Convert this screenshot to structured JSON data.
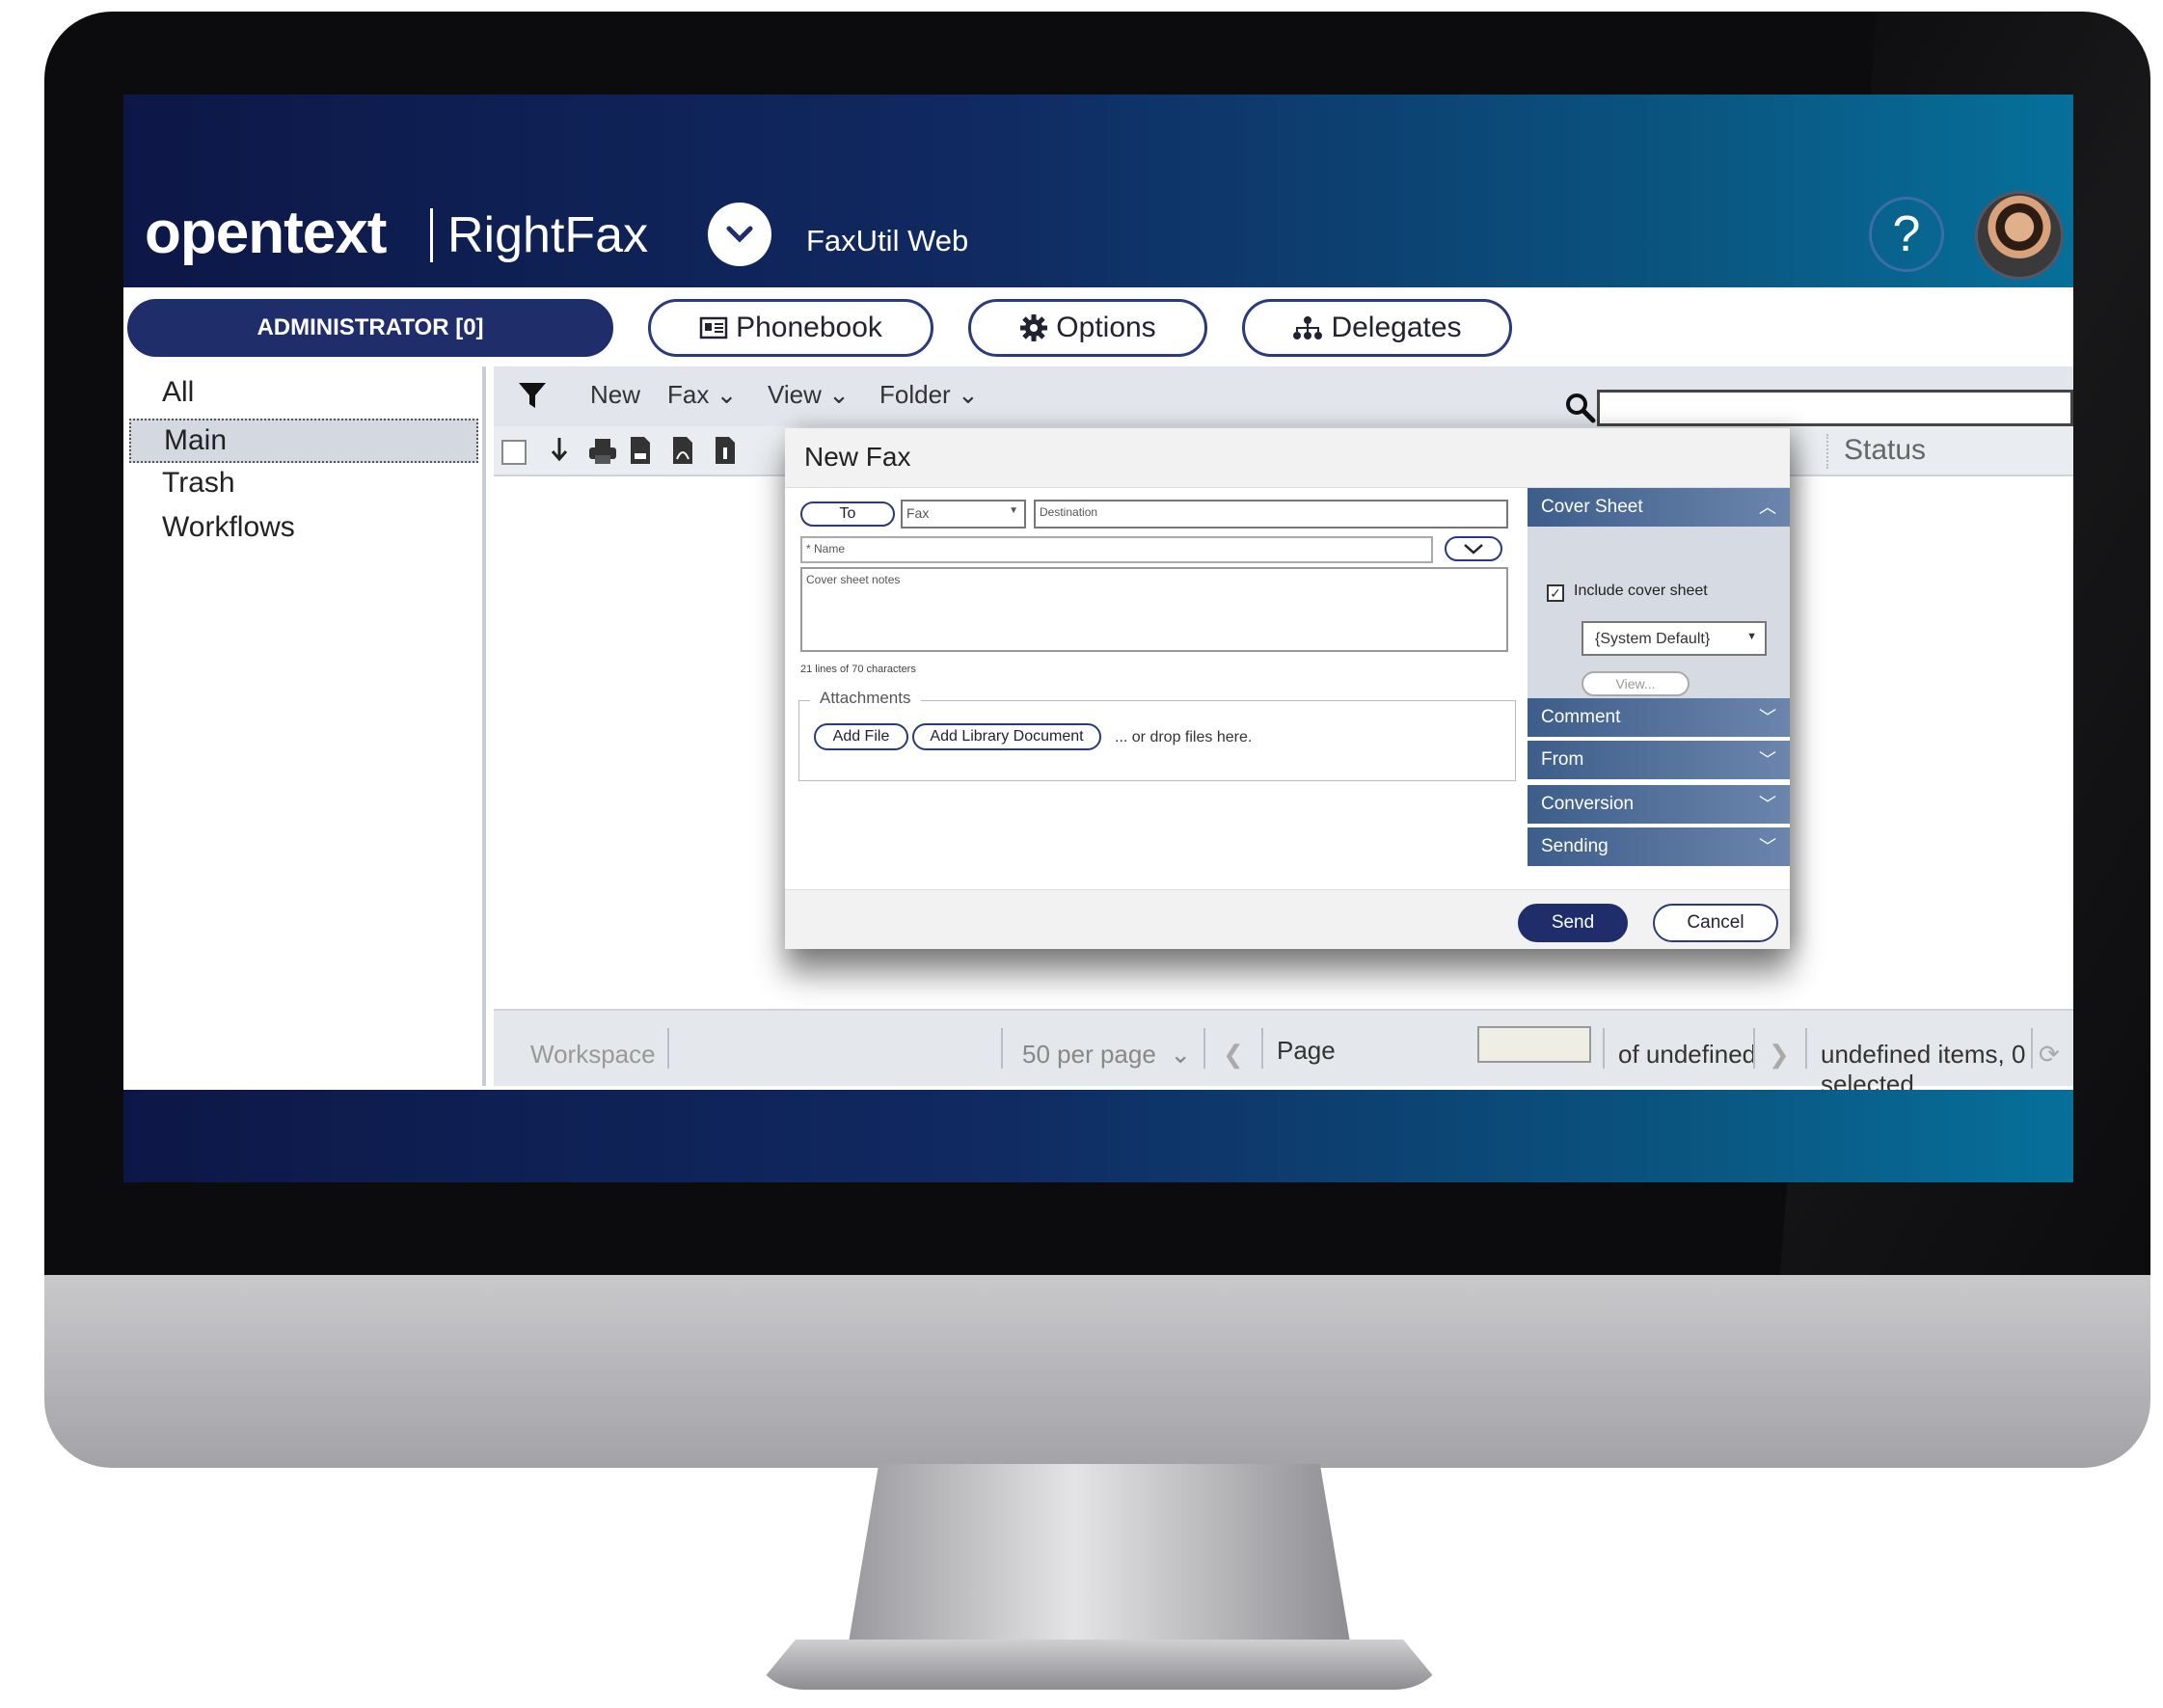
{
  "app": {
    "brand": "opentext",
    "product": "RightFax",
    "title": "FaxUtil Web",
    "help": "?"
  },
  "tabs": {
    "admin": "ADMINISTRATOR [0]",
    "phonebook": "Phonebook",
    "options": "Options",
    "delegates": "Delegates"
  },
  "sidebar": {
    "items": [
      "All",
      "Main",
      "Trash",
      "Workflows"
    ],
    "selected": "Main"
  },
  "toolbar": {
    "new": "New",
    "fax": "Fax",
    "view": "View",
    "folder": "Folder",
    "status_column": "Status"
  },
  "pager": {
    "workspace": "Workspace",
    "per_page": "50 per page",
    "page_label": "Page",
    "of_label": "of undefined",
    "items": "undefined items, 0 selected"
  },
  "modal": {
    "title": "New Fax",
    "to_button": "To",
    "type_select": "Fax",
    "destination_placeholder": "Destination",
    "name_placeholder": "* Name",
    "notes_placeholder": "Cover sheet notes",
    "notes_hint": "21 lines of 70 characters",
    "attachments_legend": "Attachments",
    "add_file": "Add File",
    "add_library": "Add Library Document",
    "drop_hint": "... or drop files here.",
    "send": "Send",
    "cancel": "Cancel",
    "panel": {
      "cover_sheet": "Cover Sheet",
      "include_cover": "Include cover sheet",
      "cover_template": "{System Default}",
      "view_button": "View...",
      "comment": "Comment",
      "from": "From",
      "conversion": "Conversion",
      "sending": "Sending"
    }
  },
  "colors": {
    "brand_dark": "#1f2d6b",
    "band_start": "#0d1747",
    "band_end": "#06709a",
    "accordion": "#3d5d8a"
  }
}
